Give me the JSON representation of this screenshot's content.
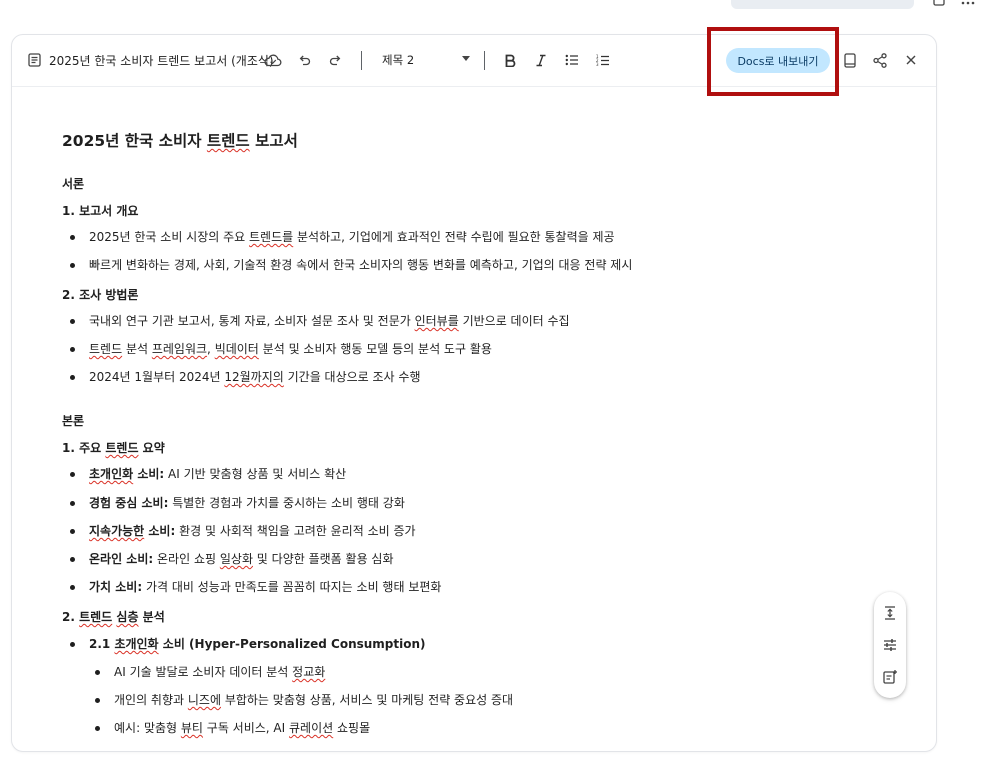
{
  "toolbar": {
    "doc_title": "2025년 한국 소비자 트렌드 보고서 (개조식)",
    "style_value": "제목 2",
    "export_label": "Docs로 내보내기"
  },
  "document": {
    "title": [
      "2025년 한국 소비자 ",
      "트렌드",
      " 보고서"
    ],
    "s_intro": "서론",
    "s1": "1. 보고서 개요",
    "s1_b1": [
      "2025년 한국 소비 시장의 주요 ",
      "트렌드를",
      " 분석하고, 기업에게 효과적인 전략 수립에 필요한 통찰력을 제공"
    ],
    "s1_b2": "빠르게 변화하는 경제, 사회, 기술적 환경 속에서 한국 소비자의 행동 변화를 예측하고, 기업의 대응 전략 제시",
    "s2": "2. 조사 방법론",
    "s2_b1": [
      "국내외 연구 기관 보고서, 통계 자료, 소비자 설문 조사 및 전문가 ",
      "인터뷰를",
      " 기반으로 데이터 수집"
    ],
    "s2_b2": [
      "트렌드",
      " 분석 ",
      "프레임워크",
      ", ",
      "빅데이터",
      " 분석 및 소비자 행동 모델 등의 분석 도구 활용"
    ],
    "s2_b3": [
      "2024년 1월부터 2024년 ",
      "12월까지의",
      " 기간을 대상으로 조사 수행"
    ],
    "s_body": "본론",
    "b1": [
      "1. 주요 ",
      "트렌드",
      " 요약"
    ],
    "t1": {
      "term": [
        "초개인화",
        " 소비:"
      ],
      "desc": " AI 기반 맞춤형 상품 및 서비스 확산"
    },
    "t2": {
      "term": "경험 중심 소비:",
      "desc": " 특별한 경험과 가치를 중시하는 소비 행태 강화"
    },
    "t3": {
      "term": [
        "지속가능한",
        " 소비:"
      ],
      "desc": " 환경 및 사회적 책임을 고려한 윤리적 소비 증가"
    },
    "t4": {
      "term": "온라인 소비:",
      "desc": [
        "온라인 쇼핑 ",
        "일상화",
        " 및 다양한 플랫폼 활용 심화"
      ]
    },
    "t5": {
      "term": "가치 소비:",
      "desc": " 가격 대비 성능과 만족도를 꼼꼼히 따지는 소비 행태 보편화"
    },
    "b2": [
      "2. ",
      "트렌드",
      " ",
      "심층",
      " 분석"
    ],
    "b2_1": [
      "2.1 ",
      "초개인화",
      " 소비 (Hyper-Personalized Consumption)"
    ],
    "b2_1_a": [
      "AI 기술 발달로 소비자 데이터 분석 ",
      "정교화"
    ],
    "b2_1_b": [
      "개인의 취향과 ",
      "니즈에",
      " 부합하는 맞춤형 상품, 서비스 및 마케팅 전략 중요성 증대"
    ],
    "b2_1_c": [
      "예시: 맞춤형 ",
      "뷰티",
      " 구독 서비스, AI ",
      "큐레이션",
      " 쇼핑몰"
    ]
  }
}
